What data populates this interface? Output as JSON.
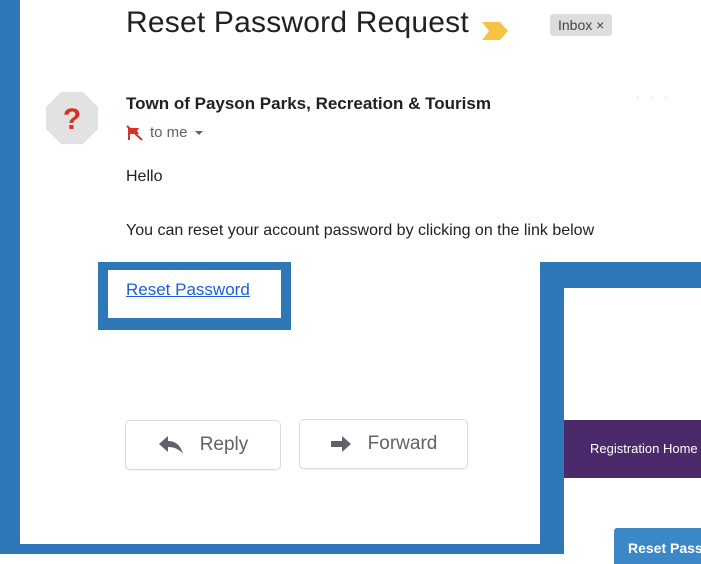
{
  "email": {
    "subject": "Reset Password Request",
    "label_chip": "Inbox ×",
    "sender_name": "Town of Payson Parks, Recreation & Tourism",
    "recipient": "to me",
    "greeting": "Hello",
    "body": "You can reset your account password by clicking on the link below",
    "link_text": "Reset Password"
  },
  "actions": {
    "reply_label": "Reply",
    "forward_label": "Forward"
  },
  "background_page": {
    "nav_text": "Registration Home",
    "button_text": "Reset Password"
  },
  "colors": {
    "annotation_blue": "#2f78b7",
    "link_blue": "#1a5fd6",
    "purple_nav": "#4a2a6b",
    "important_marker": "#f6c344"
  }
}
